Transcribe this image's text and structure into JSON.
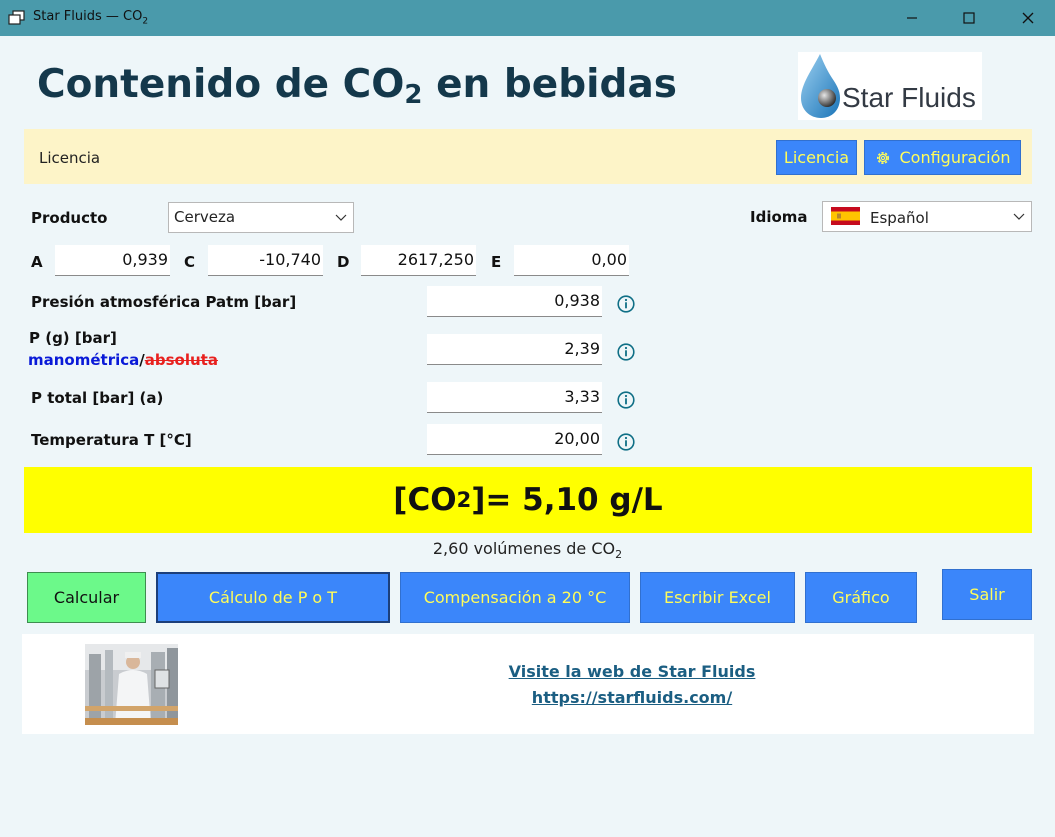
{
  "window": {
    "title_text": "Star Fluids — CO",
    "title_sub": "2",
    "controls": [
      "minimize",
      "maximize",
      "close"
    ]
  },
  "header": {
    "title_pre": "Contenido de CO",
    "title_sub": "2",
    "title_post": " en bebidas",
    "logo_text": "Star Fluids"
  },
  "license": {
    "label": "Licencia",
    "license_button": "Licencia",
    "config_button": "Configuración"
  },
  "product": {
    "label": "Producto",
    "selected": "Cerveza"
  },
  "language": {
    "label": "Idioma",
    "selected": "Español"
  },
  "coefficients": [
    {
      "label": "A",
      "value": "0,939"
    },
    {
      "label": "C",
      "value": "-10,740"
    },
    {
      "label": "D",
      "value": "2617,250"
    },
    {
      "label": "E",
      "value": "0,00"
    }
  ],
  "fields": {
    "patm": {
      "label": "Presión atmosférica Patm [bar]",
      "value": "0,938"
    },
    "pg": {
      "label": "P (g) [bar]",
      "mode_gauge": "manométrica",
      "mode_sep": "/",
      "mode_absolute": "absoluta",
      "value": "2,39"
    },
    "ptotal": {
      "label": "P total [bar] (a)",
      "value": "3,33"
    },
    "temp": {
      "label": "Temperatura T [°C]",
      "value": "20,00"
    }
  },
  "result": {
    "pre": "[CO",
    "sub": "2",
    "post": "]= 5,10 g/L",
    "volumes_pre": "2,60 volúmenes de CO",
    "volumes_sub": "2"
  },
  "actions": {
    "calcular": "Calcular",
    "calculo_pt": "Cálculo de P o T",
    "compensacion": "Compensación a 20 °C",
    "excel": "Escribir Excel",
    "grafico": "Gráfico",
    "salir": "Salir"
  },
  "footer": {
    "link_text": "Visite la web de Star Fluids",
    "link_url": "https://starfluids.com/"
  },
  "colors": {
    "titlebar": "#4a9aab",
    "button_blue": "#3b86fa",
    "button_text": "#fffd5a",
    "calcular_green": "#6cf98a",
    "result_yellow": "#ffff00",
    "license_bg": "#fdf4c8",
    "title_color": "#14384b",
    "gauge_blue": "#0a1ad8",
    "absolute_red": "#e8201e",
    "info_icon": "#0f6f86"
  }
}
